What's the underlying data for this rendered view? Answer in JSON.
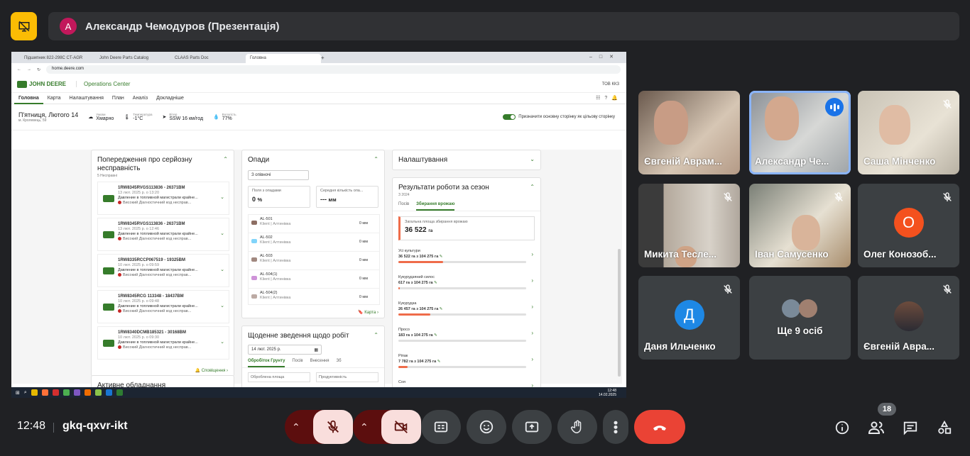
{
  "presentation": {
    "avatar_letter": "A",
    "title": "Александр Чемодуров (Презентація)"
  },
  "browser": {
    "tabs": [
      "Підшипник 822-298С CT-АGR",
      "John Deere Parts Catalog",
      "CLAAS Parts Doc",
      "Головна"
    ],
    "url": "home.deere.com"
  },
  "jd": {
    "brand": "JOHN DEERE",
    "product": "Operations Center",
    "account": "ТОВ ККЗ",
    "nav": [
      "Головна",
      "Карта",
      "Налаштування",
      "План",
      "Аналіз",
      "Докладніше"
    ],
    "date": "П'ятниця, Лютого 14",
    "location": "м. Кролевець, 59",
    "weather": [
      {
        "label": "Умови",
        "value": "Хмарно"
      },
      {
        "label": "Температура",
        "value": "-1°C"
      },
      {
        "label": "Вітер",
        "value": "SSW 16 км/год"
      },
      {
        "label": "Вологість",
        "value": "77%"
      }
    ],
    "toggle_label": "Призначити основну сторінку як цільову сторінку",
    "alerts_card": {
      "title": "Попередження про серйозну несправність",
      "subtitle": "5 Несправні",
      "items": [
        {
          "machine": "1RW8345RVGS113836 - 26371BM",
          "time": "13 лют. 2025 р. о 13:20",
          "text": "Давление в топливной магистрали крайне...",
          "meta": "Високий   Діагностичний код несправ..."
        },
        {
          "machine": "1RW8345RVGS113836 - 26371BM",
          "time": "13 лют. 2025 р. о 12:46",
          "text": "Давление в топливной магистрали крайне...",
          "meta": "Високий   Діагностичний код несправ..."
        },
        {
          "machine": "1RW8335RCCP067519 - 19325BM",
          "time": "10 лют. 2025 р. о 09:59",
          "text": "Давление в топливной магистрали крайне...",
          "meta": "Високий   Діагностичний код несправ..."
        },
        {
          "machine": "1RW8345RCG 113348 - 18437BM",
          "time": "10 лют. 2025 р. о 09:48",
          "text": "Давление в топливной магистрали крайне...",
          "meta": "Високий   Діагностичний код несправ..."
        },
        {
          "machine": "1RW8340DCMB185321 - 30168BM",
          "time": "10 лют. 2025 р. о 09:30",
          "text": "Давление в топливной магистрали крайне...",
          "meta": "Високий   Діагностичний код несправ..."
        }
      ],
      "link": "Сповіщення"
    },
    "rain_card": {
      "title": "Опади",
      "select": "З опівночі",
      "stat1_label": "Поля з опадами",
      "stat1_value": "0",
      "stat1_unit": "%",
      "stat2_label": "Середня кількість опа...",
      "stat2_value": "---",
      "stat2_unit": "мм",
      "fields": [
        {
          "name": "AL-501",
          "client": "Klient | Алтинівка",
          "value": "0 мм"
        },
        {
          "name": "AL-502",
          "client": "Klient | Алтинівка",
          "value": "0 мм"
        },
        {
          "name": "AL-503",
          "client": "Klient | Алтинівка",
          "value": "0 мм"
        },
        {
          "name": "AL-504(1)",
          "client": "Klient | Алтинівка",
          "value": "0 мм"
        },
        {
          "name": "AL-504(2)",
          "client": "Klient | Алтинівка",
          "value": "0 мм"
        }
      ],
      "link": "Карта"
    },
    "daily_card": {
      "title": "Щоденне зведення щодо робіт",
      "date": "14 лют. 2025 р.",
      "tabs": [
        "Обробіток Грунту",
        "Посів",
        "Внесення",
        "Зб"
      ],
      "stat1": "Оброблена площа",
      "stat2": "Продуктивність"
    },
    "settings_card": {
      "title": "Налаштування"
    },
    "season_card": {
      "title": "Результати роботи за сезон",
      "year": "З 2024",
      "tabs": [
        "Посів",
        "Збирання врожаю"
      ],
      "total_label": "Загальна площа збирання врожаю",
      "total_value": "36 522",
      "total_unit": "га",
      "crops": [
        {
          "name": "Усі культури",
          "value": "36 522 га з 104 275 га",
          "progress": 0.35
        },
        {
          "name": "Кукурудзяний силос",
          "value": "617 га з 104 275 га",
          "progress": 0.01
        },
        {
          "name": "Кукурудза",
          "value": "26 457 га з 104 275 га",
          "progress": 0.25
        },
        {
          "name": "Просо",
          "value": "183 га з 104 275 га",
          "progress": 0.0
        },
        {
          "name": "Ріпак",
          "value": "7 782 га з 104 275 га",
          "progress": 0.07
        },
        {
          "name": "Соя",
          "value": "",
          "progress": 0.0
        }
      ]
    },
    "bottom_card": "Активне обладнання",
    "clock": "12:48",
    "clock_date": "14.02.2025"
  },
  "participants": [
    {
      "name": "Євгеній Аврам...",
      "muted": false,
      "video": true
    },
    {
      "name": "Александр Че...",
      "muted": false,
      "video": true,
      "speaking": true
    },
    {
      "name": "Саша Мінченко",
      "muted": true,
      "video": true
    },
    {
      "name": "Микита Тесле...",
      "muted": true,
      "video": true
    },
    {
      "name": "Іван Самусенко",
      "muted": true,
      "video": true
    },
    {
      "name": "Олег Конозоб...",
      "muted": true,
      "video": false,
      "letter": "О",
      "color": "#f4511e"
    },
    {
      "name": "Даня Ильченко",
      "muted": true,
      "video": false,
      "letter": "Д",
      "color": "#1e88e5"
    },
    {
      "name": "Ще 9 осіб",
      "muted": false,
      "video": false
    },
    {
      "name": "Євгеній Авра...",
      "muted": true,
      "video": false
    }
  ],
  "bottom": {
    "time": "12:48",
    "meeting_code": "gkq-qxvr-ikt",
    "people_count": "18"
  },
  "colors": {
    "accent": "#1a73e8",
    "end_call": "#ea4335",
    "jd_green": "#367c2b",
    "presenting": "#fbbc04"
  }
}
